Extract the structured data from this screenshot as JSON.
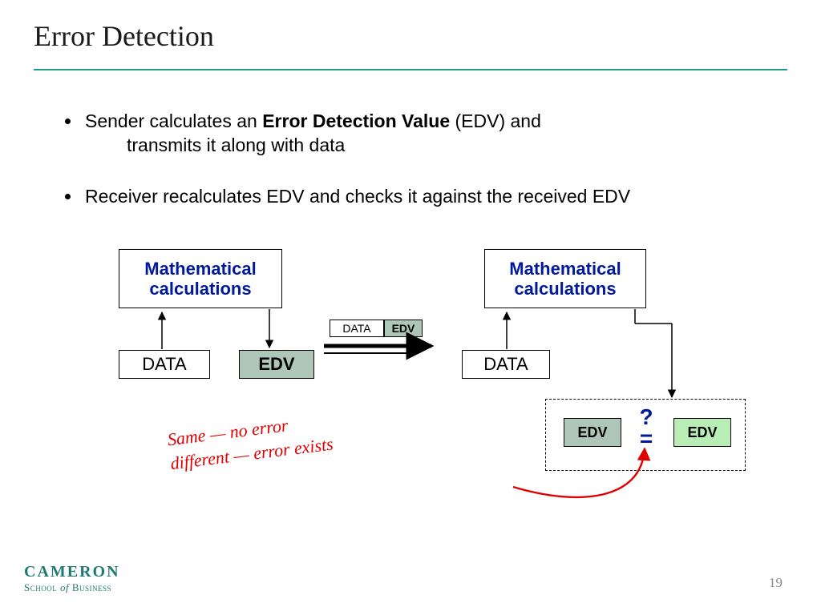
{
  "title": "Error Detection",
  "bullets": {
    "b1_pre": "Sender calculates an ",
    "b1_bold": "Error Detection Value",
    "b1_post": " (EDV) and",
    "b1_line2": "transmits it along with data",
    "b2": "Receiver recalculates EDV and checks it against the received EDV"
  },
  "labels": {
    "math": "Mathematical",
    "calc": "calculations",
    "data": "DATA",
    "edv": "EDV",
    "qe": "?\n="
  },
  "handwriting": {
    "line1": "Same  —  no  error",
    "line2": "different  —  error  exists"
  },
  "footer": {
    "logo_top": "CAMERON",
    "logo_bot_a": "School ",
    "logo_bot_of": "of",
    "logo_bot_b": " Business"
  },
  "page": "19"
}
